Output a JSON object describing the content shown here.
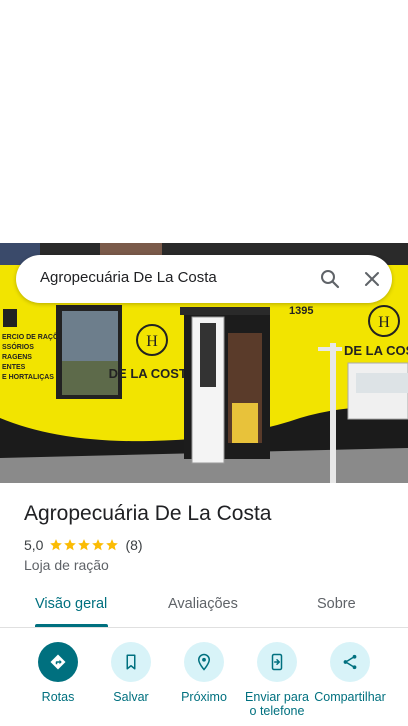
{
  "search": {
    "query": "Agropecuária De La Costa",
    "search_icon": "search-icon",
    "close_icon": "close-icon"
  },
  "photo": {
    "storefront_text": "DE LA COSTA",
    "number": "1395",
    "left_sign_lines": [
      "ERCIO DE RAÇÕES",
      "SSÓRIOS",
      "RAGENS",
      "ENTES",
      "E HORTALIÇAS"
    ],
    "colors": {
      "wall": "#f2e400",
      "base": "#1b1b1b"
    }
  },
  "place": {
    "name": "Agropecuária De La Costa",
    "rating": "5,0",
    "stars": 5,
    "review_count": "(8)",
    "category": "Loja de ração"
  },
  "tabs": [
    {
      "label": "Visão geral",
      "active": true
    },
    {
      "label": "Avaliações",
      "active": false
    },
    {
      "label": "Sobre",
      "active": false
    }
  ],
  "actions": [
    {
      "label": "Rotas",
      "icon": "directions-icon"
    },
    {
      "label": "Salvar",
      "icon": "bookmark-icon"
    },
    {
      "label": "Próximo",
      "icon": "nearby-icon"
    },
    {
      "label": "Enviar para o telefone",
      "icon": "send-to-phone-icon"
    },
    {
      "label": "Compartilhar",
      "icon": "share-icon"
    }
  ],
  "colors": {
    "accent": "#00707f",
    "accent_light": "#d8f3f8",
    "star": "#fbbc04"
  }
}
